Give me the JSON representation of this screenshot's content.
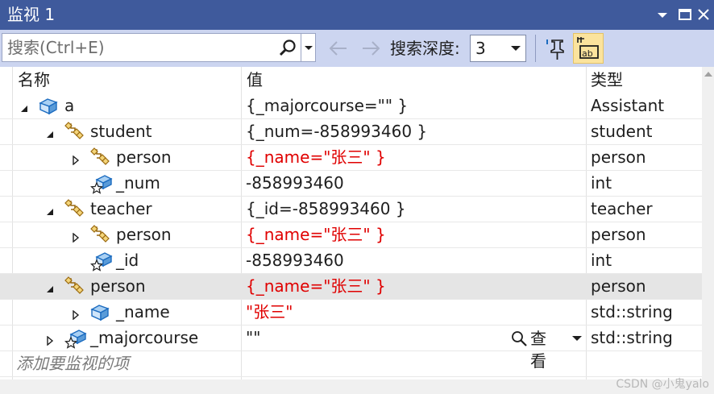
{
  "window": {
    "title": "监视 1"
  },
  "toolbar": {
    "search_placeholder": "搜索(Ctrl+E)",
    "depth_label": "搜索深度:",
    "depth_value": "3"
  },
  "columns": {
    "name": "名称",
    "value": "值",
    "type": "类型"
  },
  "rows": [
    {
      "name": "a",
      "value": "{_majorcourse=\"\" }",
      "type": "Assistant"
    },
    {
      "name": "student",
      "value": "{_num=-858993460 }",
      "type": "student"
    },
    {
      "name": "person",
      "value": "{_name=\"张三\" }",
      "type": "person"
    },
    {
      "name": "_num",
      "value": "-858993460",
      "type": "int"
    },
    {
      "name": "teacher",
      "value": "{_id=-858993460 }",
      "type": "teacher"
    },
    {
      "name": "person",
      "value": "{_name=\"张三\" }",
      "type": "person"
    },
    {
      "name": "_id",
      "value": "-858993460",
      "type": "int"
    },
    {
      "name": "person",
      "value": "{_name=\"张三\" }",
      "type": "person"
    },
    {
      "name": "_name",
      "value": "\"张三\"",
      "type": "std::string"
    },
    {
      "name": "_majorcourse",
      "value": "\"\"",
      "type": "std::string",
      "viewer_label": "查看"
    }
  ],
  "add_item_placeholder": "添加要监视的项",
  "watermark": "CSDN @小鬼yalo",
  "colors": {
    "title_bar": "#3f5a9c",
    "toolbar": "#ccd5f0",
    "changed_value": "#e00000",
    "selected_row": "#e5e5e5",
    "hex_toggle_active": "#fbe39d"
  }
}
